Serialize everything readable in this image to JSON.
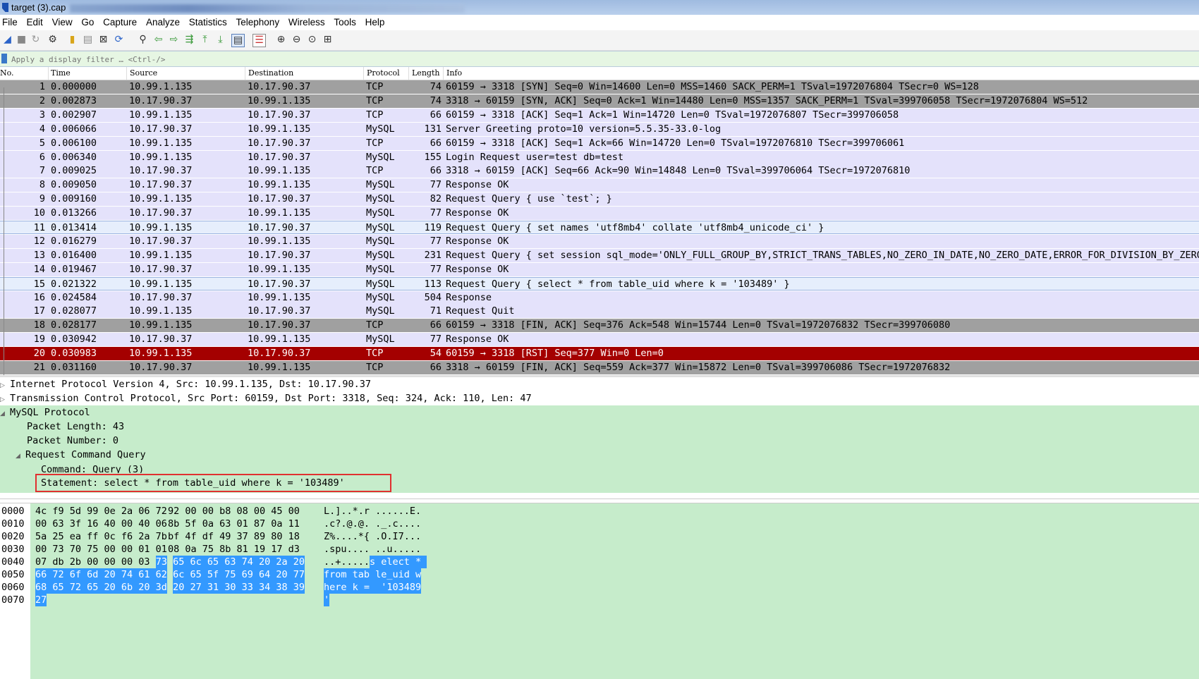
{
  "title_bar": {
    "file": "target (3).cap"
  },
  "menu": [
    "File",
    "Edit",
    "View",
    "Go",
    "Capture",
    "Analyze",
    "Statistics",
    "Telephony",
    "Wireless",
    "Tools",
    "Help"
  ],
  "filter": {
    "placeholder": "Apply a display filter … <Ctrl-/>"
  },
  "columns": [
    "No.",
    "Time",
    "Source",
    "Destination",
    "Protocol",
    "Length",
    "Info"
  ],
  "packets": [
    {
      "no": "1",
      "time": "0.000000",
      "src": "10.99.1.135",
      "dst": "10.17.90.37",
      "proto": "TCP",
      "len": "74",
      "info": "60159 → 3318 [SYN] Seq=0 Win=14600 Len=0 MSS=1460 SACK_PERM=1 TSval=1972076804 TSecr=0 WS=128",
      "style": "gray"
    },
    {
      "no": "2",
      "time": "0.002873",
      "src": "10.17.90.37",
      "dst": "10.99.1.135",
      "proto": "TCP",
      "len": "74",
      "info": "3318 → 60159 [SYN, ACK] Seq=0 Ack=1 Win=14480 Len=0 MSS=1357 SACK_PERM=1 TSval=399706058 TSecr=1972076804 WS=512",
      "style": "gray"
    },
    {
      "no": "3",
      "time": "0.002907",
      "src": "10.99.1.135",
      "dst": "10.17.90.37",
      "proto": "TCP",
      "len": "66",
      "info": "60159 → 3318 [ACK] Seq=1 Ack=1 Win=14720 Len=0 TSval=1972076807 TSecr=399706058",
      "style": "lav"
    },
    {
      "no": "4",
      "time": "0.006066",
      "src": "10.17.90.37",
      "dst": "10.99.1.135",
      "proto": "MySQL",
      "len": "131",
      "info": "Server Greeting proto=10 version=5.5.35-33.0-log",
      "style": "lav"
    },
    {
      "no": "5",
      "time": "0.006100",
      "src": "10.99.1.135",
      "dst": "10.17.90.37",
      "proto": "TCP",
      "len": "66",
      "info": "60159 → 3318 [ACK] Seq=1 Ack=66 Win=14720 Len=0 TSval=1972076810 TSecr=399706061",
      "style": "lav"
    },
    {
      "no": "6",
      "time": "0.006340",
      "src": "10.99.1.135",
      "dst": "10.17.90.37",
      "proto": "MySQL",
      "len": "155",
      "info": "Login Request user=test db=test",
      "style": "lav"
    },
    {
      "no": "7",
      "time": "0.009025",
      "src": "10.17.90.37",
      "dst": "10.99.1.135",
      "proto": "TCP",
      "len": "66",
      "info": "3318 → 60159 [ACK] Seq=66 Ack=90 Win=14848 Len=0 TSval=399706064 TSecr=1972076810",
      "style": "lav"
    },
    {
      "no": "8",
      "time": "0.009050",
      "src": "10.17.90.37",
      "dst": "10.99.1.135",
      "proto": "MySQL",
      "len": "77",
      "info": "Response OK",
      "style": "lav"
    },
    {
      "no": "9",
      "time": "0.009160",
      "src": "10.99.1.135",
      "dst": "10.17.90.37",
      "proto": "MySQL",
      "len": "82",
      "info": "Request Query { use `test`; }",
      "style": "lav"
    },
    {
      "no": "10",
      "time": "0.013266",
      "src": "10.17.90.37",
      "dst": "10.99.1.135",
      "proto": "MySQL",
      "len": "77",
      "info": "Response OK",
      "style": "lav"
    },
    {
      "no": "11",
      "time": "0.013414",
      "src": "10.99.1.135",
      "dst": "10.17.90.37",
      "proto": "MySQL",
      "len": "119",
      "info": "Request Query { set names 'utf8mb4' collate 'utf8mb4_unicode_ci' }",
      "style": "sel"
    },
    {
      "no": "12",
      "time": "0.016279",
      "src": "10.17.90.37",
      "dst": "10.99.1.135",
      "proto": "MySQL",
      "len": "77",
      "info": "Response OK",
      "style": "lav"
    },
    {
      "no": "13",
      "time": "0.016400",
      "src": "10.99.1.135",
      "dst": "10.17.90.37",
      "proto": "MySQL",
      "len": "231",
      "info": "Request Query { set session sql_mode='ONLY_FULL_GROUP_BY,STRICT_TRANS_TABLES,NO_ZERO_IN_DATE,NO_ZERO_DATE,ERROR_FOR_DIVISION_BY_ZERO,N",
      "style": "lav"
    },
    {
      "no": "14",
      "time": "0.019467",
      "src": "10.17.90.37",
      "dst": "10.99.1.135",
      "proto": "MySQL",
      "len": "77",
      "info": "Response OK",
      "style": "lav"
    },
    {
      "no": "15",
      "time": "0.021322",
      "src": "10.99.1.135",
      "dst": "10.17.90.37",
      "proto": "MySQL",
      "len": "113",
      "info": "Request Query { select * from table_uid where k = '103489' }",
      "style": "sel"
    },
    {
      "no": "16",
      "time": "0.024584",
      "src": "10.17.90.37",
      "dst": "10.99.1.135",
      "proto": "MySQL",
      "len": "504",
      "info": "Response",
      "style": "lav"
    },
    {
      "no": "17",
      "time": "0.028077",
      "src": "10.99.1.135",
      "dst": "10.17.90.37",
      "proto": "MySQL",
      "len": "71",
      "info": "Request Quit",
      "style": "lav"
    },
    {
      "no": "18",
      "time": "0.028177",
      "src": "10.99.1.135",
      "dst": "10.17.90.37",
      "proto": "TCP",
      "len": "66",
      "info": "60159 → 3318 [FIN, ACK] Seq=376 Ack=548 Win=15744 Len=0 TSval=1972076832 TSecr=399706080",
      "style": "gray"
    },
    {
      "no": "19",
      "time": "0.030942",
      "src": "10.17.90.37",
      "dst": "10.99.1.135",
      "proto": "MySQL",
      "len": "77",
      "info": "Response OK",
      "style": "lav"
    },
    {
      "no": "20",
      "time": "0.030983",
      "src": "10.99.1.135",
      "dst": "10.17.90.37",
      "proto": "TCP",
      "len": "54",
      "info": "60159 → 3318 [RST] Seq=377 Win=0 Len=0",
      "style": "red"
    },
    {
      "no": "21",
      "time": "0.031160",
      "src": "10.17.90.37",
      "dst": "10.99.1.135",
      "proto": "TCP",
      "len": "66",
      "info": "3318 → 60159 [FIN, ACK] Seq=559 Ack=377 Win=15872 Len=0 TSval=399706086 TSecr=1972076832",
      "style": "gray"
    }
  ],
  "details": {
    "ip": "Internet Protocol Version 4, Src: 10.99.1.135, Dst: 10.17.90.37",
    "tcp": "Transmission Control Protocol, Src Port: 60159, Dst Port: 3318, Seq: 324, Ack: 110, Len: 47",
    "mysql": "MySQL Protocol",
    "pkt_len": "Packet Length: 43",
    "pkt_num": "Packet Number: 0",
    "req": "Request Command Query",
    "cmd": "Command: Query (3)",
    "stmt": "Statement: select * from table_uid where k = '103489'"
  },
  "hex": [
    {
      "off": "0000",
      "a": "4c f9 5d 99 0e 2a 06 72",
      "b": "92 00 00 b8 08 00 45 00",
      "a_hl": "",
      "b_hl": "",
      "asc": "L.]..*.r ......E.",
      "asc_hl": ""
    },
    {
      "off": "0010",
      "a": "00 63 3f 16 40 00 40 06",
      "b": "8b 5f 0a 63 01 87 0a 11",
      "a_hl": "",
      "b_hl": "",
      "asc": ".c?.@.@. ._.c....",
      "asc_hl": ""
    },
    {
      "off": "0020",
      "a": "5a 25 ea ff 0c f6 2a 7b",
      "b": "bf 4f df 49 37 89 80 18",
      "a_hl": "",
      "b_hl": "",
      "asc": "Z%....*{ .O.I7...",
      "asc_hl": ""
    },
    {
      "off": "0030",
      "a": "00 73 70 75 00 00 01 01",
      "b": "08 0a 75 8b 81 19 17 d3",
      "a_hl": "",
      "b_hl": "",
      "asc": ".spu.... ..u.....",
      "asc_hl": ""
    },
    {
      "off": "0040",
      "a": "07 db 2b 00 00 00 03",
      "a_hl": "73",
      "b": "",
      "b_hl": "65 6c 65 63 74 20 2a 20",
      "asc": "..+.....",
      "asc_hl": "s elect * "
    },
    {
      "off": "0050",
      "a": "",
      "a_hl": "66 72 6f 6d 20 74 61 62",
      "b": "",
      "b_hl": "6c 65 5f 75 69 64 20 77",
      "asc": "",
      "asc_hl": "from tab le_uid w"
    },
    {
      "off": "0060",
      "a": "",
      "a_hl": "68 65 72 65 20 6b 20 3d",
      "b": "",
      "b_hl": "20 27 31 30 33 34 38 39",
      "asc": "",
      "asc_hl": "here k =  '103489"
    },
    {
      "off": "0070",
      "a": "",
      "a_hl": "27",
      "b": "",
      "b_hl": "",
      "asc": "",
      "asc_hl": "'"
    }
  ]
}
